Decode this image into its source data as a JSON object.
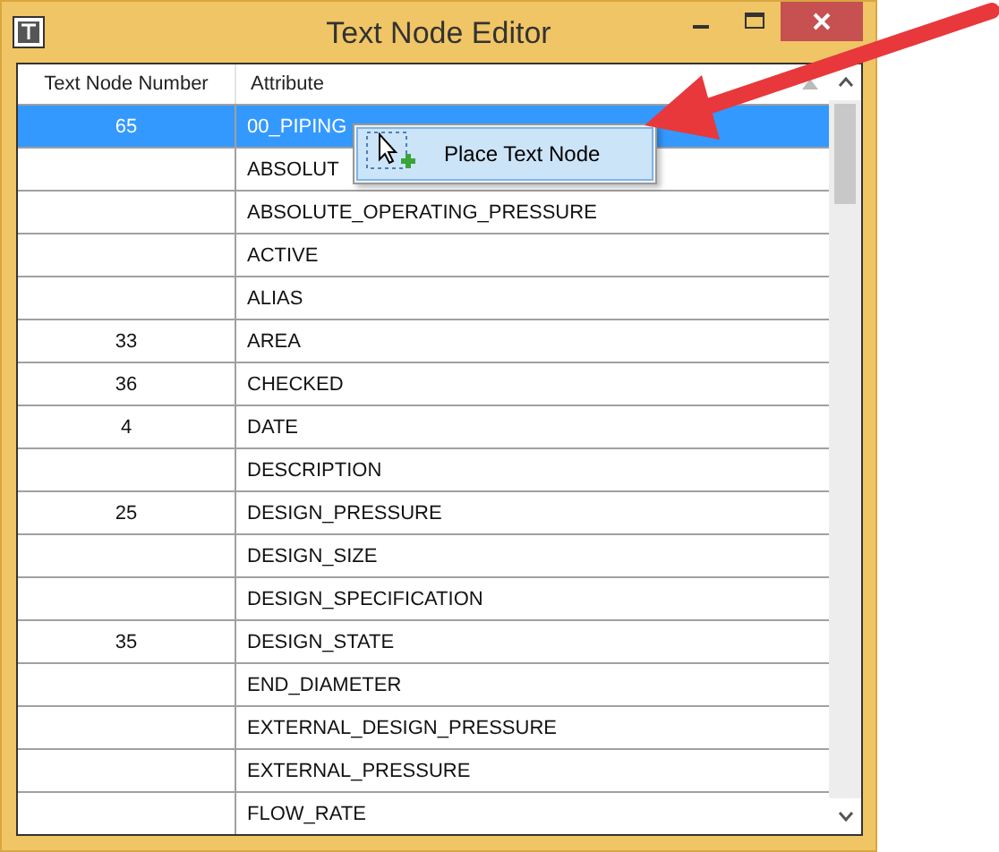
{
  "window": {
    "title": "Text Node Editor"
  },
  "table": {
    "columns": [
      "Text Node Number",
      "Attribute"
    ],
    "rows": [
      {
        "number": "65",
        "attribute": "00_PIPING",
        "selected": true
      },
      {
        "number": "",
        "attribute": "ABSOLUT",
        "selected": false
      },
      {
        "number": "",
        "attribute": "ABSOLUTE_OPERATING_PRESSURE",
        "selected": false
      },
      {
        "number": "",
        "attribute": "ACTIVE",
        "selected": false
      },
      {
        "number": "",
        "attribute": "ALIAS",
        "selected": false
      },
      {
        "number": "33",
        "attribute": "AREA",
        "selected": false
      },
      {
        "number": "36",
        "attribute": "CHECKED",
        "selected": false
      },
      {
        "number": "4",
        "attribute": "DATE",
        "selected": false
      },
      {
        "number": "",
        "attribute": "DESCRIPTION",
        "selected": false
      },
      {
        "number": "25",
        "attribute": "DESIGN_PRESSURE",
        "selected": false
      },
      {
        "number": "",
        "attribute": "DESIGN_SIZE",
        "selected": false
      },
      {
        "number": "",
        "attribute": "DESIGN_SPECIFICATION",
        "selected": false
      },
      {
        "number": "35",
        "attribute": "DESIGN_STATE",
        "selected": false
      },
      {
        "number": "",
        "attribute": "END_DIAMETER",
        "selected": false
      },
      {
        "number": "",
        "attribute": "EXTERNAL_DESIGN_PRESSURE",
        "selected": false
      },
      {
        "number": "",
        "attribute": "EXTERNAL_PRESSURE",
        "selected": false
      },
      {
        "number": "",
        "attribute": "FLOW_RATE",
        "selected": false
      }
    ]
  },
  "context_menu": {
    "items": [
      {
        "label": "Place Text Node"
      }
    ]
  }
}
